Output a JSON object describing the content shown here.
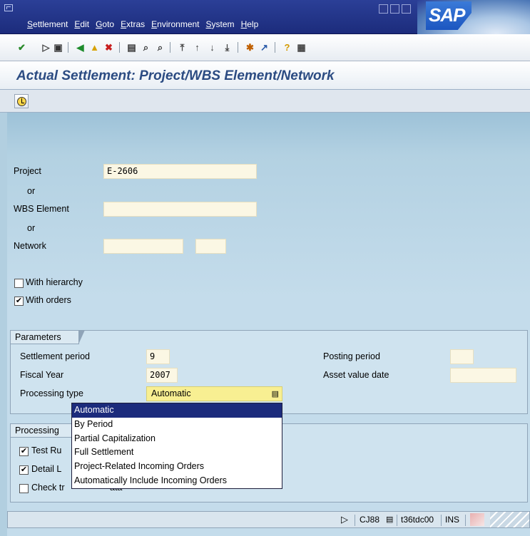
{
  "window": {
    "menu": [
      "Settlement",
      "Edit",
      "Goto",
      "Extras",
      "Environment",
      "System",
      "Help"
    ],
    "logo_text": "SAP"
  },
  "screen": {
    "title": "Actual Settlement: Project/WBS Element/Network"
  },
  "form": {
    "project_label": "Project",
    "project_value": "E-2606",
    "or1": "or",
    "wbs_label": "WBS Element",
    "wbs_value": "",
    "or2": "or",
    "network_label": "Network",
    "network_value": "",
    "network_value2": "",
    "with_hierarchy_label": "With hierarchy",
    "with_hierarchy_checked": false,
    "with_orders_label": "With orders",
    "with_orders_checked": true
  },
  "parameters": {
    "group_title": "Parameters",
    "settlement_period_label": "Settlement period",
    "settlement_period_value": "9",
    "fiscal_year_label": "Fiscal Year",
    "fiscal_year_value": "2007",
    "processing_type_label": "Processing type",
    "processing_type_value": "Automatic",
    "posting_period_label": "Posting period",
    "posting_period_value": "",
    "asset_value_date_label": "Asset value date",
    "asset_value_date_value": ""
  },
  "processing_options": {
    "group_title": "Processing",
    "test_run_label": "Test Ru",
    "test_run_checked": true,
    "detail_lists_label": "Detail L",
    "detail_lists_checked": true,
    "check_trans_label": "Check tr",
    "check_trans_suffix": "ata",
    "check_trans_checked": false
  },
  "dropdown": {
    "options": [
      "Automatic",
      "By Period",
      "Partial Capitalization",
      "Full Settlement",
      "Project-Related Incoming Orders",
      "Automatically Include Incoming Orders"
    ],
    "selected_index": 0
  },
  "statusbar": {
    "transaction": "CJ88",
    "server": "t36tdc00",
    "mode": "INS"
  }
}
